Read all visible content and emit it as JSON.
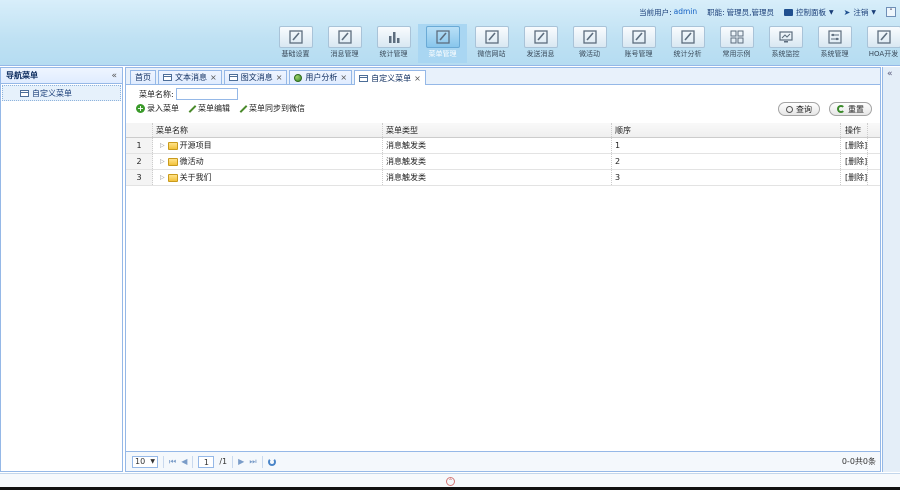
{
  "header": {
    "current_user_label": "当前用户:",
    "current_user": "admin",
    "role_label": "职能:",
    "role": "管理员,管理员",
    "dashboard_label": "控制面板",
    "logout_label": "注销",
    "modules": [
      {
        "label": "基础设置",
        "icon": "edit-icon"
      },
      {
        "label": "消息管理",
        "icon": "edit-icon"
      },
      {
        "label": "统计管理",
        "icon": "bar-chart-icon"
      },
      {
        "label": "菜单管理",
        "icon": "edit-icon",
        "active": true
      },
      {
        "label": "微信网站",
        "icon": "edit-icon"
      },
      {
        "label": "发送消息",
        "icon": "edit-icon"
      },
      {
        "label": "微活动",
        "icon": "edit-icon"
      },
      {
        "label": "账号管理",
        "icon": "edit-icon"
      },
      {
        "label": "统计分析",
        "icon": "edit-icon"
      },
      {
        "label": "常用示例",
        "icon": "grid-icon"
      },
      {
        "label": "系统监控",
        "icon": "monitor-icon"
      },
      {
        "label": "系统管理",
        "icon": "settings-panel-icon"
      },
      {
        "label": "HOA开发",
        "icon": "edit-icon"
      }
    ]
  },
  "leftnav": {
    "title": "导航菜单",
    "collapse_glyph": "«",
    "items": [
      {
        "label": "自定义菜单"
      }
    ]
  },
  "tabs": [
    {
      "label": "首页",
      "closable": false
    },
    {
      "label": "文本消息",
      "closable": true
    },
    {
      "label": "图文消息",
      "closable": true
    },
    {
      "label": "用户分析",
      "closable": true
    },
    {
      "label": "自定义菜单",
      "closable": true,
      "active": true
    }
  ],
  "toolbar": {
    "search_label": "菜单名称:",
    "search_value": "",
    "add_label": "录入菜单",
    "edit_label": "菜单编辑",
    "sync_label": "菜单同步到微信",
    "query_label": "查询",
    "reset_label": "重置"
  },
  "grid": {
    "columns": [
      "菜单名称",
      "菜单类型",
      "顺序",
      "操作"
    ],
    "rows": [
      {
        "num": "1",
        "name": "开源项目",
        "type": "消息触发类",
        "order": "1",
        "op": "[删除]"
      },
      {
        "num": "2",
        "name": "微活动",
        "type": "消息触发类",
        "order": "2",
        "op": "[删除]"
      },
      {
        "num": "3",
        "name": "关于我们",
        "type": "消息触发类",
        "order": "3",
        "op": "[删除]"
      }
    ]
  },
  "pager": {
    "page_size": "10",
    "page_number": "1",
    "page_total": "/1",
    "info": "0-0共0条"
  },
  "right_strip": {
    "collapse_glyph": "«"
  }
}
